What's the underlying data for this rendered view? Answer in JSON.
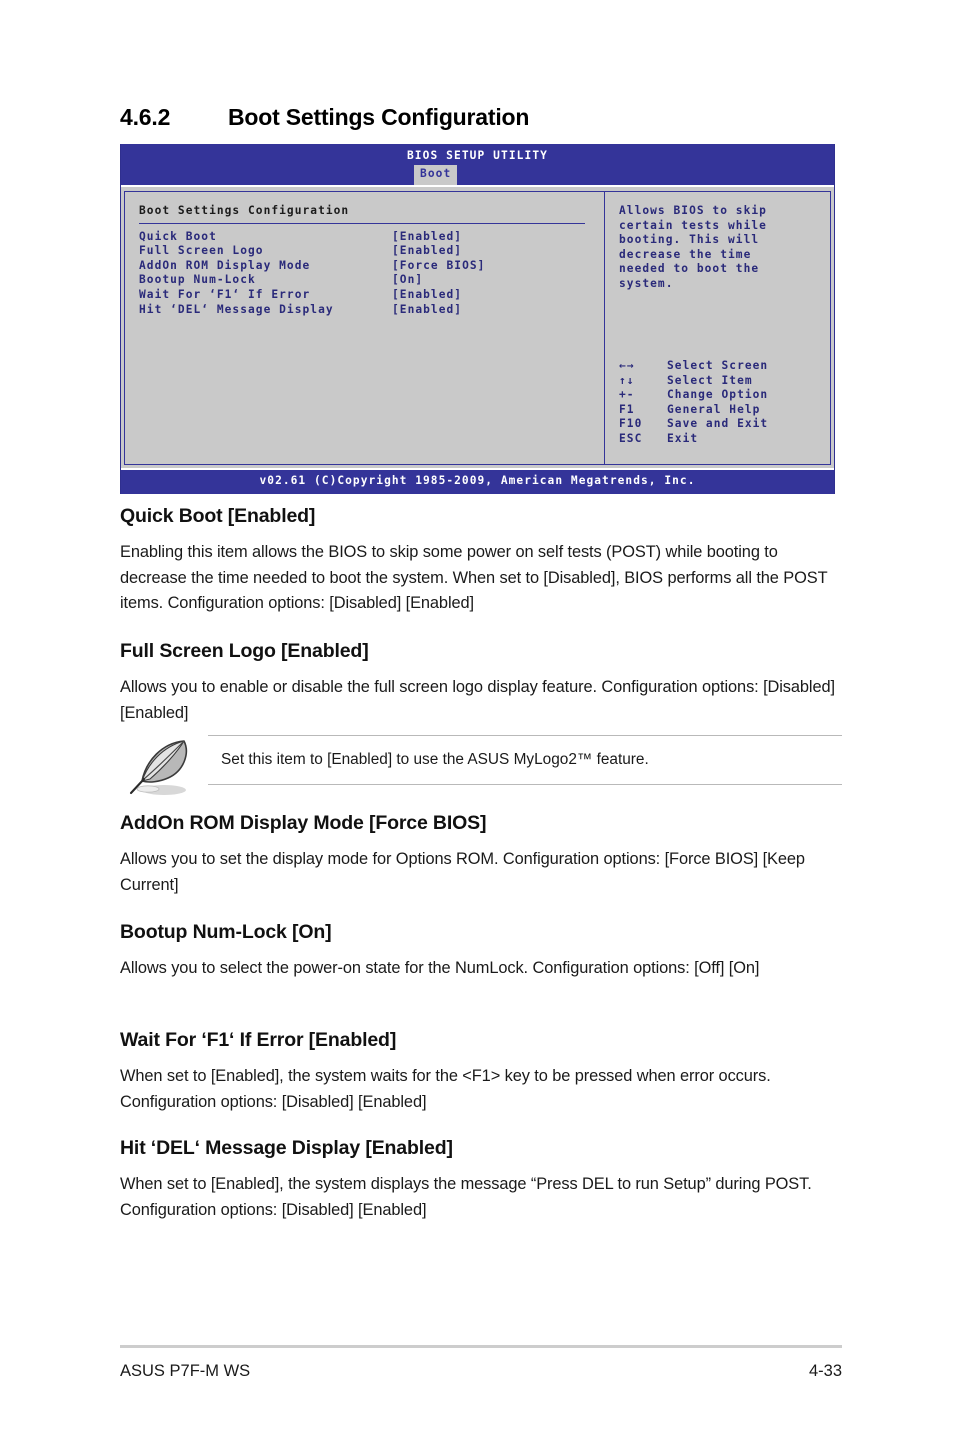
{
  "document": {
    "section_number": "4.6.2",
    "section_title": "Boot Settings Configuration"
  },
  "bios": {
    "title": "BIOS SETUP UTILITY",
    "active_tab": "Boot",
    "group_title": "Boot Settings Configuration",
    "settings": [
      {
        "label": "Quick Boot",
        "value": "[Enabled]"
      },
      {
        "label": "Full Screen Logo",
        "value": "[Enabled]"
      },
      {
        "label": "AddOn ROM Display Mode",
        "value": "[Force BIOS]"
      },
      {
        "label": "Bootup Num-Lock",
        "value": "[On]"
      },
      {
        "label": "Wait For ‘F1‘ If Error",
        "value": "[Enabled]"
      },
      {
        "label": "Hit ‘DEL‘ Message Display",
        "value": "[Enabled]"
      }
    ],
    "help_lines": [
      "Allows BIOS to skip",
      "certain tests while",
      "booting. This will",
      "decrease the time",
      "needed to boot the",
      "system."
    ],
    "keys": [
      {
        "key": "←→",
        "desc": "Select Screen"
      },
      {
        "key": "↑↓",
        "desc": "Select Item"
      },
      {
        "key": "+-",
        "desc": "Change Option"
      },
      {
        "key": "F1",
        "desc": "General Help"
      },
      {
        "key": "F10",
        "desc": "Save and Exit"
      },
      {
        "key": "ESC",
        "desc": "Exit"
      }
    ],
    "footer": "v02.61 (C)Copyright 1985-2009, American Megatrends, Inc.",
    "colors": {
      "screen_blue": "#343499",
      "panel_gray": "#c9c9c9",
      "text_blue": "#2a2a7a"
    }
  },
  "items": [
    {
      "heading": "Quick Boot [Enabled]",
      "body": "Enabling this item allows the BIOS to skip some power on self tests (POST) while booting to decrease the time needed to boot the system. When set to [Disabled], BIOS performs all the POST items. Configuration options: [Disabled] [Enabled]"
    },
    {
      "heading": "Full Screen Logo [Enabled]",
      "body": "Allows you to enable or disable the full screen logo display feature. Configuration options: [Disabled] [Enabled]"
    },
    {
      "heading": "AddOn ROM Display Mode [Force BIOS]",
      "body": "Allows you to set the display mode for Options ROM. Configuration options: [Force BIOS] [Keep Current]"
    },
    {
      "heading": "Bootup Num-Lock [On]",
      "body": "Allows you to select the power-on state for the NumLock. Configuration options: [Off] [On]"
    },
    {
      "heading": "Wait For ‘F1‘ If Error [Enabled]",
      "body": "When set to [Enabled], the system waits for the <F1> key to be pressed when error occurs. Configuration options: [Disabled] [Enabled]"
    },
    {
      "heading": "Hit ‘DEL‘ Message Display [Enabled]",
      "body": "When set to [Enabled], the system displays the message “Press DEL to run Setup” during POST. Configuration options: [Disabled] [Enabled]"
    }
  ],
  "note": {
    "icon": "quill-pen-icon",
    "text": "Set this item to [Enabled] to use the ASUS MyLogo2™ feature."
  },
  "footer": {
    "product": "ASUS P7F-M WS",
    "page_number": "4-33"
  }
}
